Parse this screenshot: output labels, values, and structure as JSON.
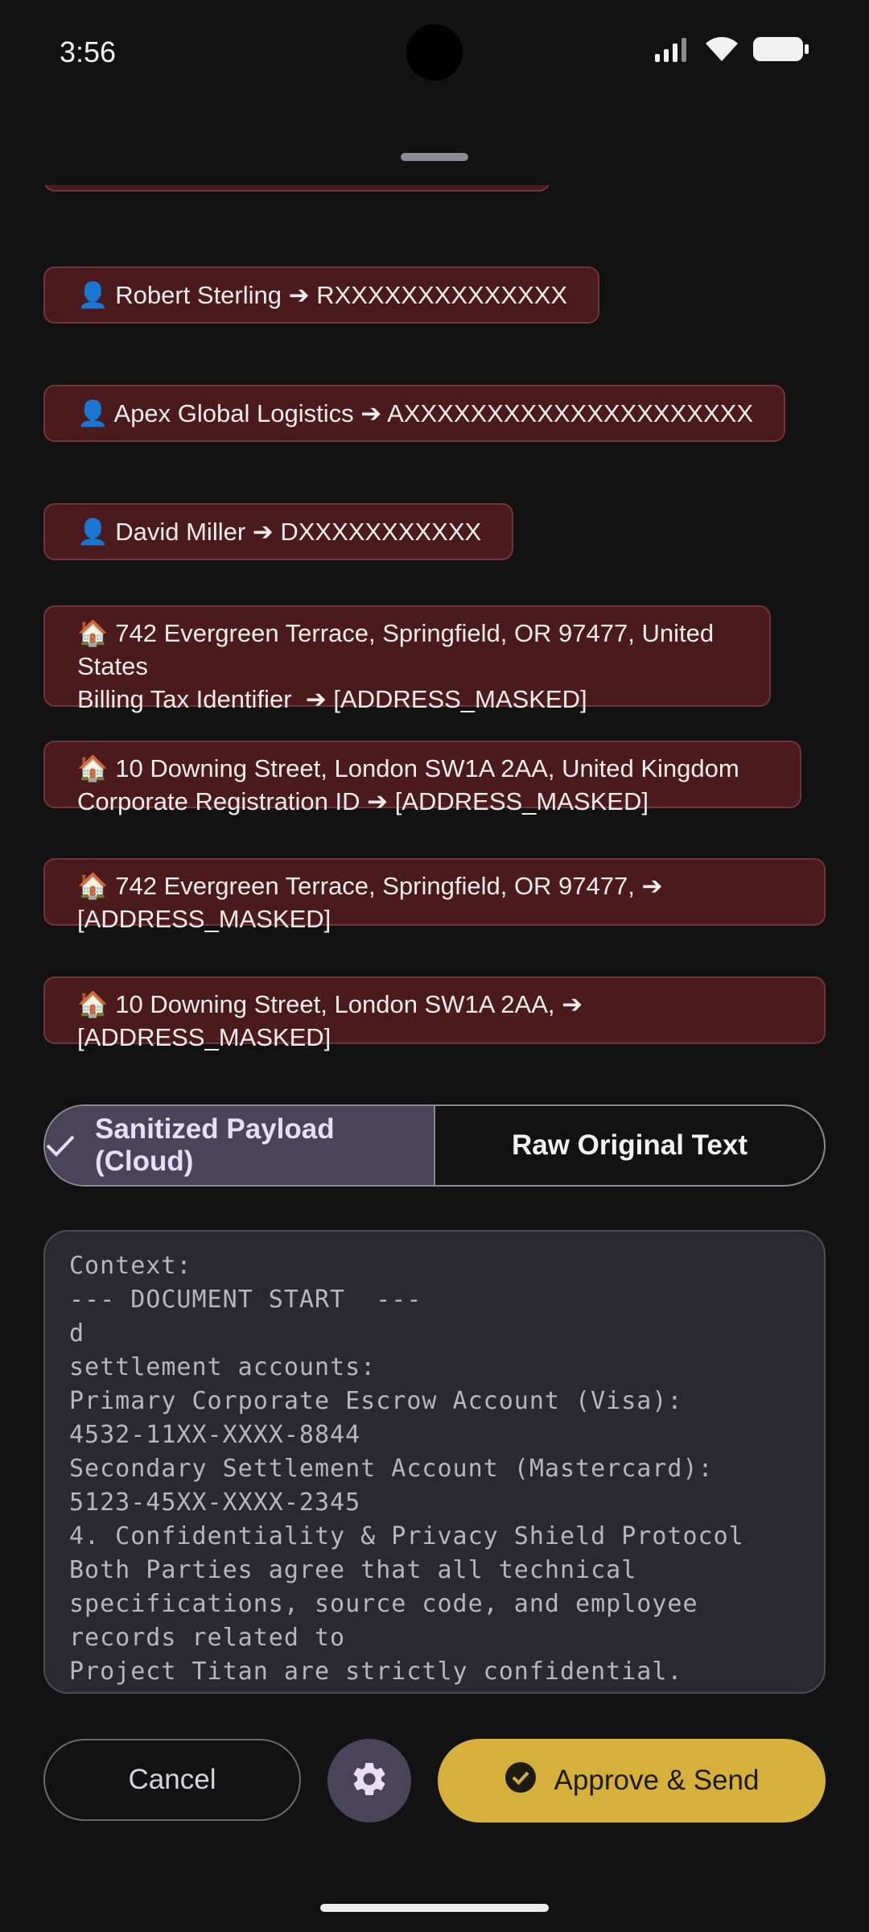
{
  "status": {
    "time": "3:56",
    "icons": [
      "signal-icon",
      "wifi-icon",
      "battery-icon"
    ]
  },
  "entities": [
    {
      "icon": "👤",
      "text": "Robert Sterling ➔ RXXXXXXXXXXXXXX"
    },
    {
      "icon": "👤",
      "text": "Apex Global Logistics ➔ AXXXXXXXXXXXXXXXXXXXXX"
    },
    {
      "icon": "👤",
      "text": "David Miller ➔ DXXXXXXXXXXX"
    },
    {
      "icon": "🏠",
      "text": "742 Evergreen Terrace, Springfield, OR 97477, United States\nBilling Tax Identifier  ➔ [ADDRESS_MASKED]"
    },
    {
      "icon": "🏠",
      "text": "10 Downing Street, London SW1A 2AA, United Kingdom\nCorporate Registration ID ➔ [ADDRESS_MASKED]"
    },
    {
      "icon": "🏠",
      "text": "742 Evergreen Terrace, Springfield, OR 97477,  ➔ [ADDRESS_MASKED]"
    },
    {
      "icon": "🏠",
      "text": "10 Downing Street, London SW1A 2AA,  ➔ [ADDRESS_MASKED]"
    }
  ],
  "toggle": {
    "selected": "Sanitized Payload (Cloud)",
    "other": "Raw Original Text"
  },
  "payload_text": "Context:\n--- DOCUMENT START  ---\nd\nsettlement accounts:\nPrimary Corporate Escrow Account (Visa):\n4532-11XX-XXXX-8844\nSecondary Settlement Account (Mastercard):\n5123-45XX-XXXX-2345\n4. Confidentiality & Privacy Shield Protocol\nBoth Parties agree that all technical\nspecifications, source code, and employee\nrecords related to\nProject Titan are strictly confidential.",
  "actions": {
    "cancel": "Cancel",
    "approve": "Approve & Send"
  },
  "colors": {
    "chip_bg": "#4a1a1c",
    "accent": "#d5b03a",
    "selected_segment": "#4a4458"
  }
}
